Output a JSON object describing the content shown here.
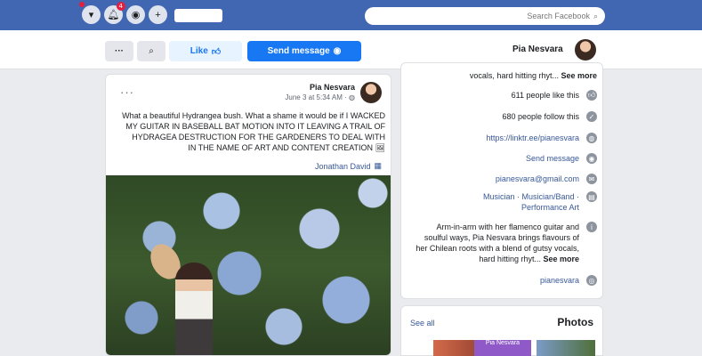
{
  "topbar": {
    "notification_count": "4",
    "search_placeholder": "Search Facebook"
  },
  "header": {
    "page_name": "Pia Nesvara",
    "more_label": "···",
    "like_label": "Like",
    "send_message_label": "Send message"
  },
  "post": {
    "author": "Pia Nesvara",
    "timestamp": "June 3 at 5:34 AM · ",
    "text_first": "What a beautiful Hydrangea bush. What a shame it would be if I",
    "text_rest": "WACKED MY GUITAR IN BASEBALL BAT MOTION INTO IT LEAVING A TRAIL OF HYDRAGEA DESTRUCTION FOR THE GARDENERS TO DEAL WITH IN THE NAME OF ART AND CONTENT CREATION",
    "photo_credit": "Jonathan David"
  },
  "about": {
    "intro_top": "vocals, hard hitting rhyt... ",
    "see_more_1": "See more",
    "likes": "611 people like this",
    "follows": "680 people follow this",
    "link": "https://linktr.ee/pianesvara",
    "send_message": "Send message",
    "email": "pianesvara@gmail.com",
    "category": "Musician · Musician/Band · Performance Art",
    "intro_full": "Arm-in-arm with her flamenco guitar and soulful ways, Pia Nesvara brings flavours of her Chilean roots with a blend of gutsy vocals, hard hitting rhyt... ",
    "see_more_2": "See more",
    "instagram": "pianesvara"
  },
  "photos": {
    "title": "Photos",
    "see_all": "See all",
    "thumb_label": "Pia Nesvara"
  }
}
